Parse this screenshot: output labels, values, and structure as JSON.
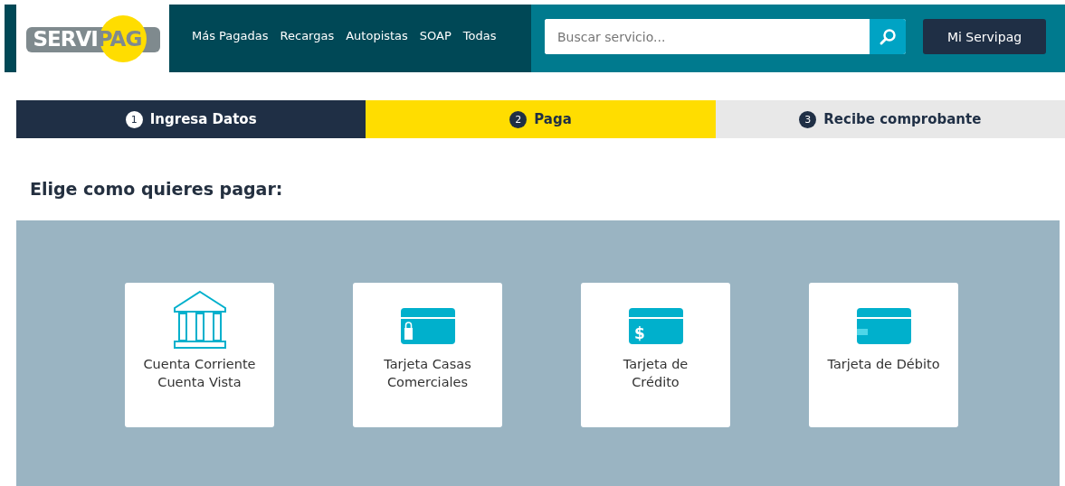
{
  "header": {
    "logo": {
      "part_1": "SERVI",
      "part_2": "PAG"
    },
    "nav": [
      "Más Pagadas",
      "Recargas",
      "Autopistas",
      "SOAP",
      "Todas"
    ],
    "search": {
      "placeholder": "Buscar servicio..."
    },
    "account_button": "Mi Servipag"
  },
  "steps": [
    {
      "number": "1",
      "label": "Ingresa Datos",
      "selected": false
    },
    {
      "number": "2",
      "label": "Paga",
      "selected": true
    },
    {
      "number": "3",
      "label": "Recibe comprobante",
      "selected": false
    }
  ],
  "heading": "Elige como quieres pagar:",
  "payment_options": [
    {
      "kind": "bank",
      "lines": [
        "Cuenta Corriente",
        "Cuenta Vista"
      ]
    },
    {
      "kind": "card-bag",
      "lines": [
        "Tarjeta Casas",
        "Comerciales"
      ]
    },
    {
      "kind": "card-dollar",
      "glyph": "$",
      "lines": [
        "Tarjeta de",
        "Crédito"
      ]
    },
    {
      "kind": "card-plain",
      "lines": [
        "Tarjeta de Débito"
      ]
    }
  ]
}
